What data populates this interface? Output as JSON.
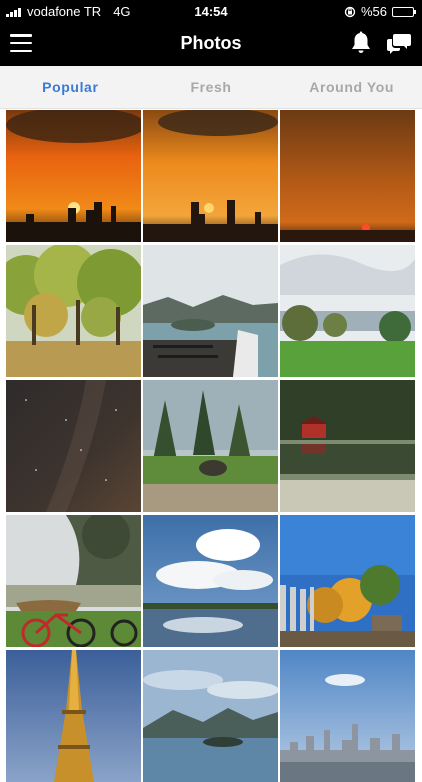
{
  "status_bar": {
    "carrier": "vodafone TR",
    "network": "4G",
    "time": "14:54",
    "battery_text": "%56",
    "battery_level": 0.56
  },
  "header": {
    "title": "Photos"
  },
  "tabs": [
    {
      "label": "Popular",
      "active": true
    },
    {
      "label": "Fresh",
      "active": false
    },
    {
      "label": "Around You",
      "active": false
    }
  ],
  "colors": {
    "accent": "#3a7bd5",
    "header_bg": "#000000",
    "tab_bg": "#f3f3f3",
    "tab_inactive": "#a8a8a8"
  },
  "photos": [
    {
      "subject": "sunset-city-skyline"
    },
    {
      "subject": "sunset-city-skyline-2"
    },
    {
      "subject": "sunset-over-sea"
    },
    {
      "subject": "autumn-park-trees"
    },
    {
      "subject": "balcony-lake-view"
    },
    {
      "subject": "green-lawn-river"
    },
    {
      "subject": "milky-way-night-sky"
    },
    {
      "subject": "pine-forest-park"
    },
    {
      "subject": "red-cabin-lake"
    },
    {
      "subject": "bicycles-foggy-lake"
    },
    {
      "subject": "clouds-reflection"
    },
    {
      "subject": "autumn-sculpture-park"
    },
    {
      "subject": "eiffel-tower"
    },
    {
      "subject": "harbor-mountains"
    },
    {
      "subject": "city-skyline-aerial"
    }
  ]
}
